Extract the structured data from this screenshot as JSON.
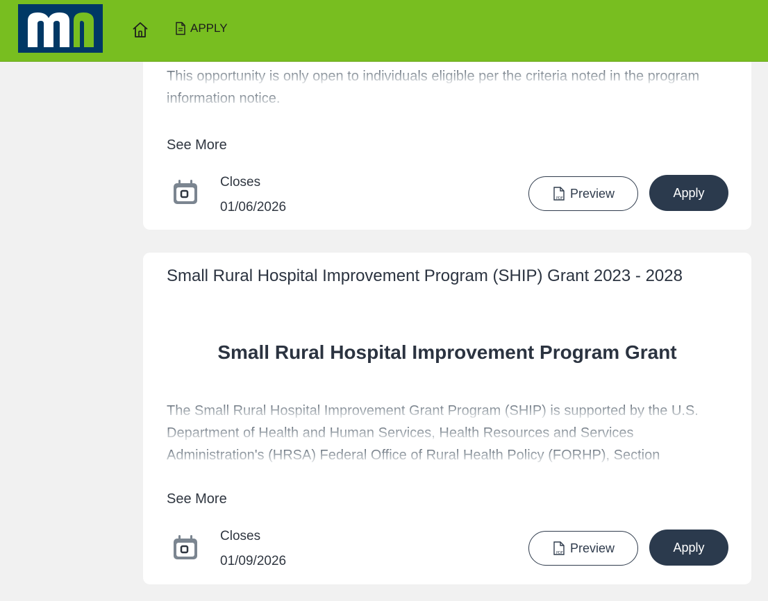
{
  "header": {
    "logo_alt": "mn",
    "home_icon": "home-icon",
    "apply_icon": "document-icon",
    "apply_label": "APPLY",
    "colors": {
      "bar": "#78be20",
      "logo_bg": "#003865"
    }
  },
  "cards": [
    {
      "description": "This opportunity is only open to individuals eligible per the criteria noted in the program information notice.",
      "see_more": "See More",
      "closes_label": "Closes",
      "closes_date": "01/06/2026",
      "preview_label": "Preview",
      "apply_label": "Apply"
    },
    {
      "title": "Small Rural Hospital Improvement Program (SHIP) Grant 2023 - 2028",
      "heading": "Small Rural Hospital Improvement Program Grant",
      "description": "The Small Rural Hospital Improvement Grant Program (SHIP) is supported by the U.S. Department of Health and Human Services, Health Resources and Services Administration's (HRSA) Federal Office of Rural Health Policy (FORHP), Section",
      "see_more": "See More",
      "closes_label": "Closes",
      "closes_date": "01/09/2026",
      "preview_label": "Preview",
      "apply_label": "Apply"
    }
  ]
}
